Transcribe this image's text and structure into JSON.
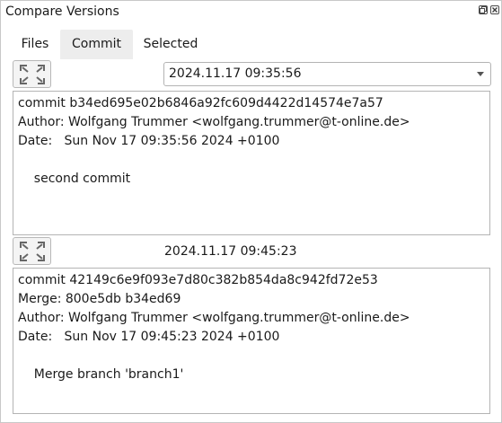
{
  "window": {
    "title": "Compare Versions"
  },
  "tabs": [
    {
      "label": "Files"
    },
    {
      "label": "Commit"
    },
    {
      "label": "Selected"
    }
  ],
  "commit_a": {
    "dropdown_value": "2024.11.17 09:35:56",
    "lines": [
      "commit b34ed695e02b6846a92fc609d4422d14574e7a57",
      "Author: Wolfgang Trummer <wolfgang.trummer@t-online.de>",
      "Date:   Sun Nov 17 09:35:56 2024 +0100",
      "",
      "    second commit"
    ]
  },
  "commit_b": {
    "label": "2024.11.17 09:45:23",
    "lines": [
      "commit 42149c6e9f093e7d80c382b854da8c942fd72e53",
      "Merge: 800e5db b34ed69",
      "Author: Wolfgang Trummer <wolfgang.trummer@t-online.de>",
      "Date:   Sun Nov 17 09:45:23 2024 +0100",
      "",
      "    Merge branch 'branch1'"
    ]
  },
  "icons": {
    "expand": "expand-icon",
    "float": "float-window-icon",
    "close": "close-icon"
  }
}
